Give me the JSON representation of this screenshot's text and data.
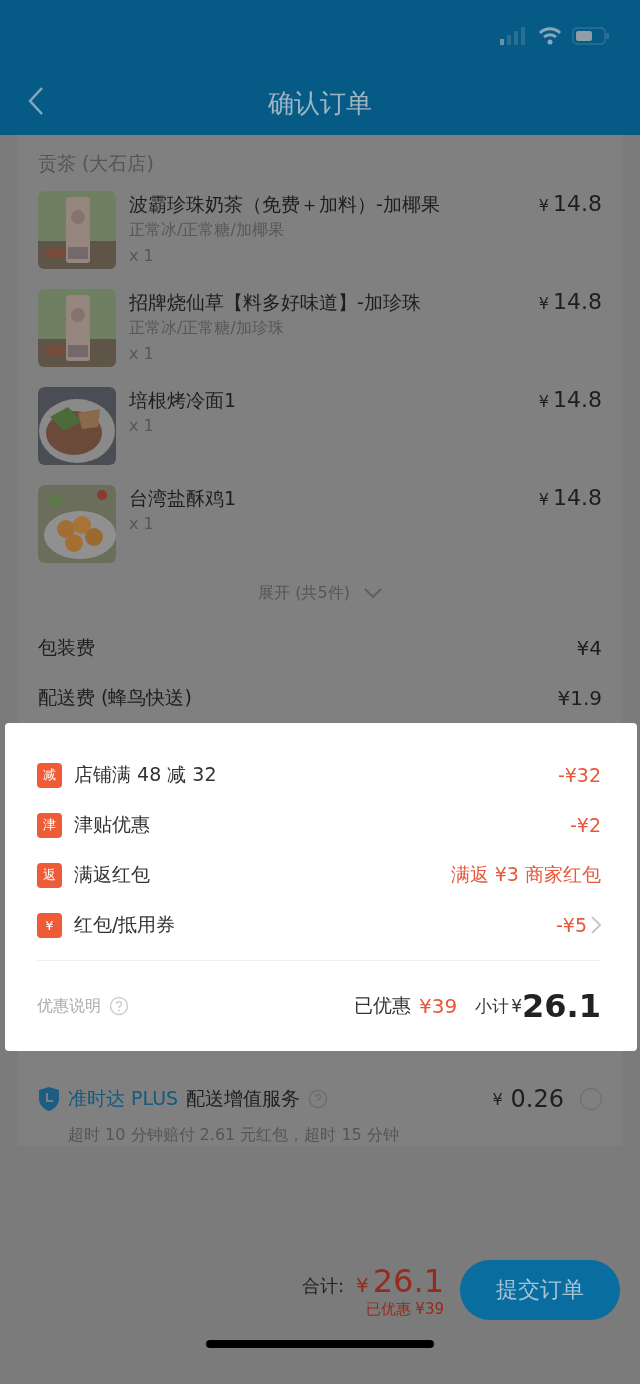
{
  "header": {
    "title": "确认订单"
  },
  "shop": {
    "name": "贡茶 (大石店)"
  },
  "items": [
    {
      "name": "波霸珍珠奶茶（免费＋加料）-加椰果",
      "specs": "正常冰/正常糖/加椰果",
      "quantity": "x 1",
      "currency": "¥",
      "price": "14.8"
    },
    {
      "name": "招牌烧仙草【料多好味道】-加珍珠",
      "specs": "正常冰/正常糖/加珍珠",
      "quantity": "x 1",
      "currency": "¥",
      "price": "14.8"
    },
    {
      "name": "培根烤冷面1",
      "quantity": "x 1",
      "currency": "¥",
      "price": "14.8"
    },
    {
      "name": "台湾盐酥鸡1",
      "quantity": "x 1",
      "currency": "¥",
      "price": "14.8"
    }
  ],
  "expand": {
    "label": "展开 (共5件)"
  },
  "fees": [
    {
      "label": "包装费",
      "value": "¥4"
    },
    {
      "label": "配送费 (蜂鸟快送)",
      "value": "¥1.9"
    }
  ],
  "discounts": {
    "rows": [
      {
        "badge": "减",
        "label": "店铺满 48 减 32",
        "value": "-¥32",
        "kind": "plain"
      },
      {
        "badge": "津",
        "label": "津贴优惠",
        "value": "-¥2",
        "kind": "plain"
      },
      {
        "badge": "返",
        "label": "满返红包",
        "value": "满返 ¥3 商家红包",
        "kind": "plain"
      },
      {
        "badge": "¥",
        "label": "红包/抵用券",
        "value": "-¥5",
        "kind": "link"
      }
    ],
    "note": "优惠说明",
    "saved_label": "已优惠",
    "saved_value": "¥39",
    "subtotal_label": "小计",
    "subtotal_currency": "¥",
    "subtotal_value": "26.1"
  },
  "plus_service": {
    "brand": "准时达 PLUS",
    "label": "配送增值服务",
    "currency": "¥",
    "price": "0.26",
    "selected": false,
    "description": "超时 10 分钟赔付 2.61 元红包，超时 15 分钟"
  },
  "bottom_bar": {
    "total_label": "合计:",
    "currency": "¥",
    "total": "26.1",
    "saved": "已优惠 ¥39",
    "submit": "提交订单"
  }
}
